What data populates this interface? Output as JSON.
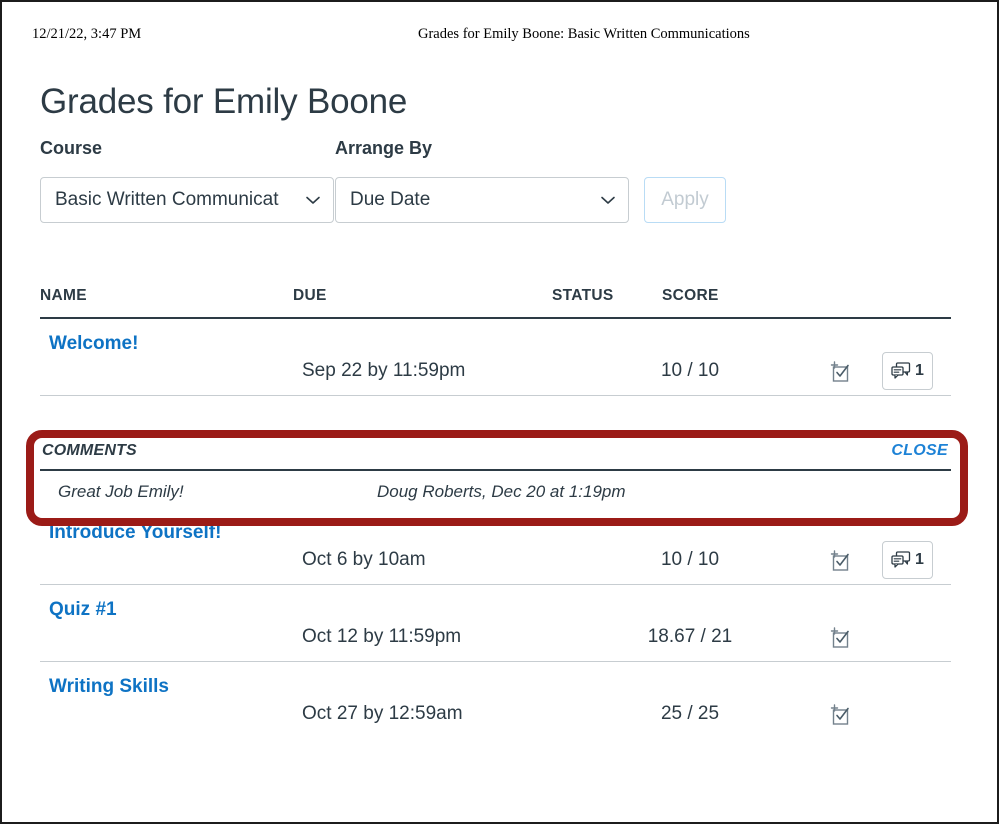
{
  "print_header": {
    "date": "12/21/22, 3:47 PM",
    "doc_title": "Grades for Emily Boone: Basic Written Communications"
  },
  "page_title": "Grades for Emily Boone",
  "filters": {
    "course_label": "Course",
    "course_value": "Basic Written Communicat",
    "arrange_label": "Arrange By",
    "arrange_value": "Due Date",
    "apply_label": "Apply",
    "chevron_icon": "chevron-down-icon"
  },
  "table": {
    "headers": {
      "name": "NAME",
      "due": "DUE",
      "status": "STATUS",
      "score": "SCORE"
    },
    "rows": [
      {
        "name": "Welcome!",
        "due": "Sep 22 by 11:59pm",
        "score": "10 / 10",
        "rubric_icon": "rubric-checklist-icon",
        "comment_icon": "comment-bubbles-icon",
        "comment_count": "1"
      },
      {
        "name": "Introduce Yourself!",
        "due": "Oct 6 by 10am",
        "score": "10 / 10",
        "rubric_icon": "rubric-checklist-icon",
        "comment_icon": "comment-bubbles-icon",
        "comment_count": "1"
      },
      {
        "name": "Quiz #1",
        "due": "Oct 12 by 11:59pm",
        "score": "18.67 / 21",
        "rubric_icon": "rubric-checklist-icon",
        "comment_count": null
      },
      {
        "name": "Writing Skills",
        "due": "Oct 27 by 12:59am",
        "score": "25 / 25",
        "rubric_icon": "rubric-checklist-icon",
        "comment_count": null
      }
    ]
  },
  "comments_panel": {
    "title": "COMMENTS",
    "close_label": "CLOSE",
    "comment_text": "Great Job Emily!",
    "comment_author": "Doug Roberts, Dec 20 at 1:19pm"
  },
  "colors": {
    "link_blue": "#0e73c4",
    "annotation_red": "#9b1b17",
    "text_dark": "#2d3b45",
    "rule_gray": "#c7cdd1"
  }
}
